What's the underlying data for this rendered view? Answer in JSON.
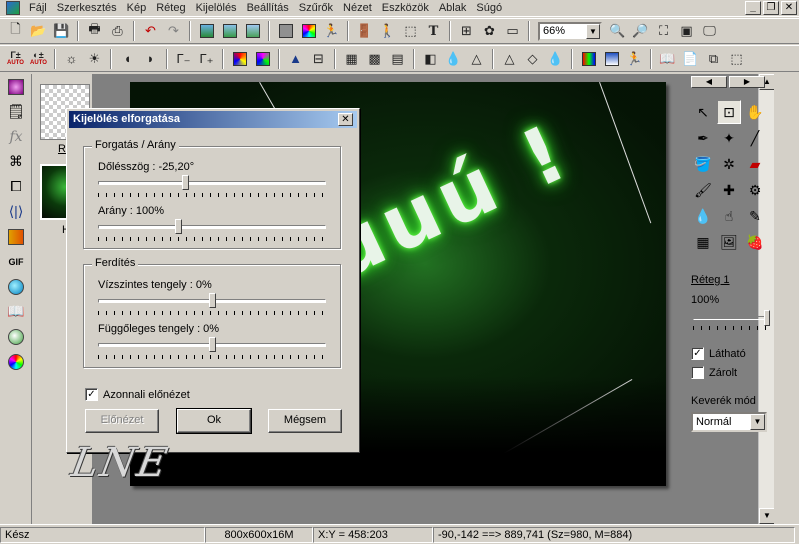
{
  "menubar": {
    "items": [
      "Fájl",
      "Szerkesztés",
      "Kép",
      "Réteg",
      "Kijelölés",
      "Beállítás",
      "Szűrők",
      "Nézet",
      "Eszközök",
      "Ablak",
      "Súgó"
    ]
  },
  "toolbar": {
    "zoom_value": "66%",
    "text_tool_glyph": "T"
  },
  "toolbar2": {
    "auto_label": "AUTO"
  },
  "thumbs": {
    "first_label": "R",
    "second_label": "H"
  },
  "right_panel": {
    "layer_name": "Réteg 1",
    "opacity": "100%",
    "visible_label": "Látható",
    "visible_checked": true,
    "locked_label": "Zárolt",
    "locked_checked": false,
    "blend_label": "Keverék mód",
    "blend_value": "Normál"
  },
  "dialog": {
    "title": "Kijelölés elforgatása",
    "group1_title": "Forgatás / Arány",
    "tilt_label": "Dőlésszög : -25,20°",
    "tilt_fraction": 0.38,
    "ratio_label": "Arány : 100%",
    "ratio_fraction": 0.35,
    "group2_title": "Ferdítés",
    "horizontal_label": "Vízszintes tengely : 0%",
    "horizontal_fraction": 0.5,
    "vertical_label": "Függőleges tengely : 0%",
    "vertical_fraction": 0.5,
    "preview_check_label": "Azonnali előnézet",
    "preview_checked": true,
    "btn_preview": "Előnézet",
    "btn_ok": "Ok",
    "btn_cancel": "Mégsem",
    "close_glyph": "✕"
  },
  "canvas": {
    "text": "uuú !"
  },
  "watermark": "LNE",
  "statusbar": {
    "status": "Kész",
    "image_size": "800x600x16M",
    "coords": "X:Y = 458:203",
    "selection": "-90,-142 ==> 889,741 (Sz=980, M=884)"
  }
}
